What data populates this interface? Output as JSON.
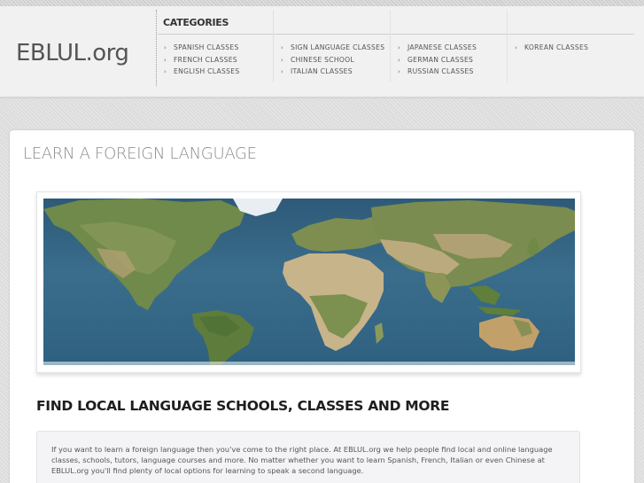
{
  "site": {
    "logo": "EBLUL.org"
  },
  "nav": {
    "title": "CATEGORIES",
    "columns": [
      [
        "SPANISH CLASSES",
        "FRENCH CLASSES",
        "ENGLISH CLASSES"
      ],
      [
        "SIGN LANGUAGE CLASSES",
        "CHINESE SCHOOL",
        "ITALIAN CLASSES"
      ],
      [
        "JAPANESE CLASSES",
        "GERMAN CLASSES",
        "RUSSIAN CLASSES"
      ],
      [
        "KOREAN CLASSES"
      ]
    ],
    "arrow_glyph": "›"
  },
  "main": {
    "title": "LEARN A FOREIGN LANGUAGE",
    "image": "world-map",
    "heading": "FIND LOCAL LANGUAGE SCHOOLS, CLASSES AND MORE",
    "intro": "If you want to learn a foreign language then you've come to the right place. At EBLUL.org we help people find local and online language classes, schools, tutors, language courses and more. No matter whether you want to learn Spanish, French, Italian or even Chinese at EBLUL.org you'll find plenty of local options for learning to speak a second language."
  },
  "colors": {
    "page_bg": "#dcdcdc",
    "header_bg": "#f1f1f1",
    "panel_bg": "#ffffff",
    "ocean": "#2f6080",
    "land_green": "#6f8a4a",
    "land_desert": "#c8b48a"
  }
}
